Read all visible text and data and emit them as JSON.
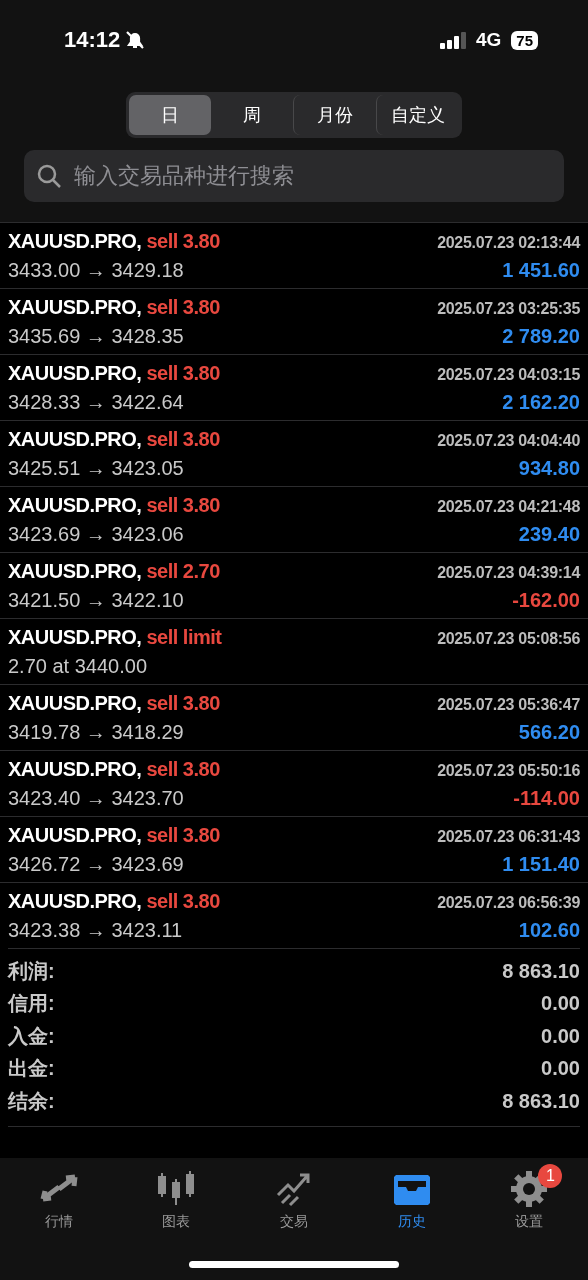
{
  "status_bar": {
    "time": "14:12",
    "network": "4G",
    "battery": "75"
  },
  "periods": [
    {
      "label": "日",
      "selected": true
    },
    {
      "label": "周",
      "selected": false
    },
    {
      "label": "月份",
      "selected": false
    },
    {
      "label": "自定义",
      "selected": false
    }
  ],
  "search": {
    "placeholder": "输入交易品种进行搜索"
  },
  "trades": [
    {
      "symbol": "XAUUSD.PRO,",
      "order": "sell 3.80",
      "time": "2025.07.23 02:13:44",
      "prices": "3433.00 → 3429.18",
      "profit": "1 451.60",
      "color": "#2f8cf0"
    },
    {
      "symbol": "XAUUSD.PRO,",
      "order": "sell 3.80",
      "time": "2025.07.23 03:25:35",
      "prices": "3435.69 → 3428.35",
      "profit": "2 789.20",
      "color": "#2f8cf0"
    },
    {
      "symbol": "XAUUSD.PRO,",
      "order": "sell 3.80",
      "time": "2025.07.23 04:03:15",
      "prices": "3428.33 → 3422.64",
      "profit": "2 162.20",
      "color": "#2f8cf0"
    },
    {
      "symbol": "XAUUSD.PRO,",
      "order": "sell 3.80",
      "time": "2025.07.23 04:04:40",
      "prices": "3425.51 → 3423.05",
      "profit": "934.80",
      "color": "#2f8cf0"
    },
    {
      "symbol": "XAUUSD.PRO,",
      "order": "sell 3.80",
      "time": "2025.07.23 04:21:48",
      "prices": "3423.69 → 3423.06",
      "profit": "239.40",
      "color": "#2f8cf0"
    },
    {
      "symbol": "XAUUSD.PRO,",
      "order": "sell 2.70",
      "time": "2025.07.23 04:39:14",
      "prices": "3421.50 → 3422.10",
      "profit": "-162.00",
      "color": "#e8483f"
    },
    {
      "symbol": "XAUUSD.PRO,",
      "order": "sell limit",
      "time": "2025.07.23 05:08:56",
      "prices": "2.70 at 3440.00"
    },
    {
      "symbol": "XAUUSD.PRO,",
      "order": "sell 3.80",
      "time": "2025.07.23 05:36:47",
      "prices": "3419.78 → 3418.29",
      "profit": "566.20",
      "color": "#2f8cf0"
    },
    {
      "symbol": "XAUUSD.PRO,",
      "order": "sell 3.80",
      "time": "2025.07.23 05:50:16",
      "prices": "3423.40 → 3423.70",
      "profit": "-114.00",
      "color": "#e8483f"
    },
    {
      "symbol": "XAUUSD.PRO,",
      "order": "sell 3.80",
      "time": "2025.07.23 06:31:43",
      "prices": "3426.72 → 3423.69",
      "profit": "1 151.40",
      "color": "#2f8cf0"
    },
    {
      "symbol": "XAUUSD.PRO,",
      "order": "sell 3.80",
      "time": "2025.07.23 06:56:39",
      "prices": "3423.38 → 3423.11",
      "profit": "102.60",
      "color": "#2f8cf0"
    }
  ],
  "summary": [
    {
      "label": "利润:",
      "value": "8 863.10"
    },
    {
      "label": "信用:",
      "value": "0.00"
    },
    {
      "label": "入金:",
      "value": "0.00"
    },
    {
      "label": "出金:",
      "value": "0.00"
    },
    {
      "label": "结余:",
      "value": "8 863.10"
    }
  ],
  "nav": [
    {
      "label": "行情",
      "kind": "quotes",
      "selected": false
    },
    {
      "label": "图表",
      "kind": "chart",
      "selected": false
    },
    {
      "label": "交易",
      "kind": "trade",
      "selected": false
    },
    {
      "label": "历史",
      "kind": "history",
      "selected": true
    },
    {
      "label": "设置",
      "kind": "settings",
      "selected": false,
      "badge": "1"
    }
  ]
}
